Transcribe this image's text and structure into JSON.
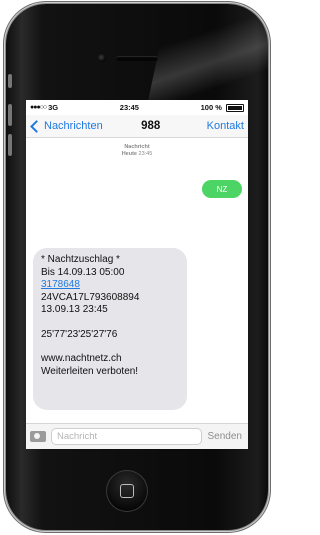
{
  "status_bar": {
    "carrier": "3G",
    "time": "23:45",
    "battery_percent": "100 %"
  },
  "nav": {
    "back_label": "Nachrichten",
    "title": "988",
    "right_label": "Kontakt"
  },
  "thread": {
    "date_label": "Nachricht",
    "date_day": "Heute",
    "date_time": "23:45"
  },
  "messages": {
    "sent": {
      "text": "NZ"
    },
    "received": {
      "lines": [
        "* Nachtzuschlag *",
        "Bis 14.09.13 05:00",
        "3178648",
        "24VCA17L793608894",
        "13.09.13 23:45",
        "25'77'23'25'27'76",
        "www.nachtnetz.ch",
        "Weiterleiten verboten!"
      ]
    }
  },
  "composer": {
    "placeholder": "Nachricht",
    "send_label": "Senden"
  },
  "icons": {
    "back": "chevron-left-icon",
    "camera": "camera-icon",
    "battery": "battery-icon",
    "signal": "signal-dots-icon",
    "home": "home-button-icon"
  },
  "colors": {
    "accent": "#1f7ae0",
    "sent_bubble": "#4cd465",
    "received_bubble": "#e5e5ea"
  }
}
